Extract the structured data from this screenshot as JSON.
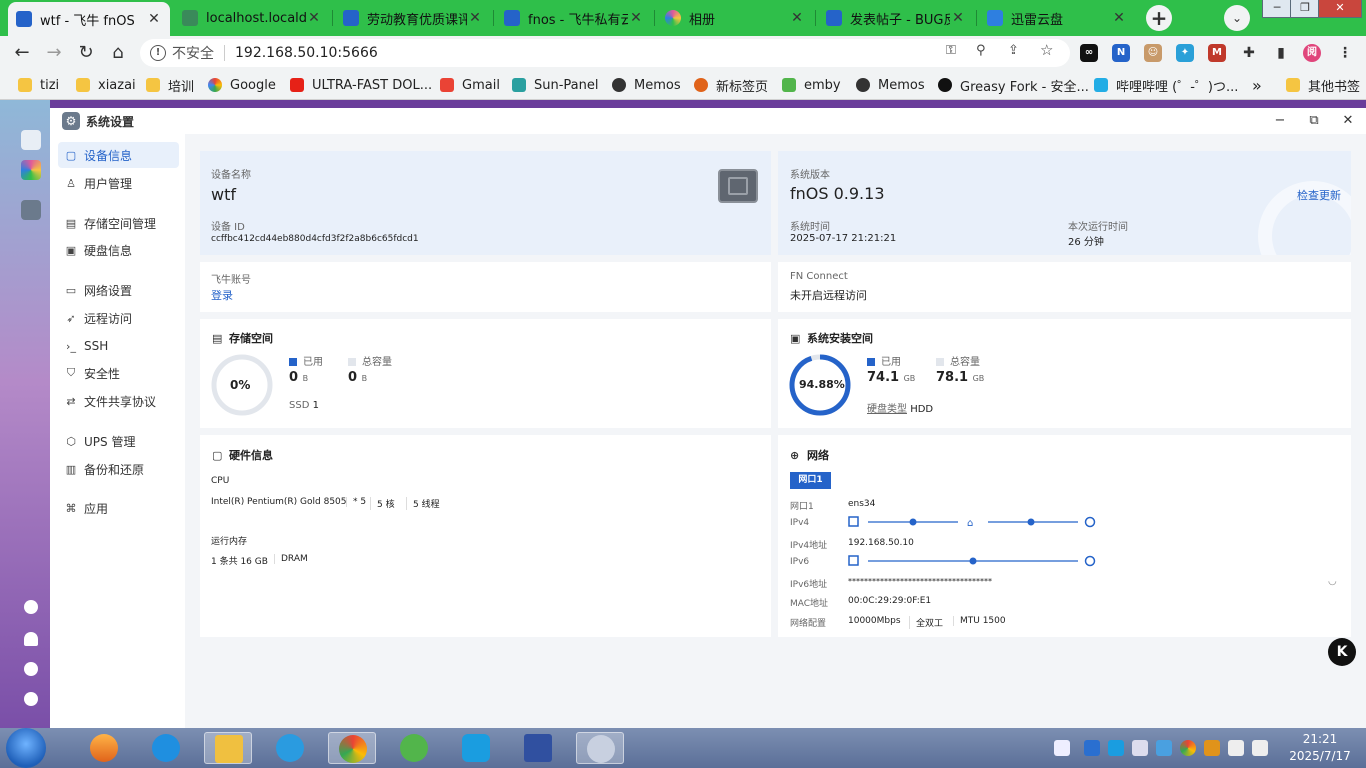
{
  "browser": {
    "tabs": [
      {
        "label": "wtf - 飞牛 fnOS",
        "color": "#2563c9",
        "active": true
      },
      {
        "label": "localhost.localdo",
        "color": "#3a8a5a"
      },
      {
        "label": "劳动教育优质课评",
        "color": "#2563c9"
      },
      {
        "label": "fnos - 飞牛私有云",
        "color": "#2563c9"
      },
      {
        "label": "相册",
        "color": "#e05a9a"
      },
      {
        "label": "发表帖子 - BUG反",
        "color": "#2563c9"
      },
      {
        "label": "迅雷云盘",
        "color": "#2e7fe0"
      }
    ],
    "close_glyph": "✕",
    "new_tab": "+",
    "address": {
      "insecure_label": "不安全",
      "url": "192.168.50.10:5666"
    },
    "bookmarks": [
      {
        "label": "tizi",
        "icon": "folder"
      },
      {
        "label": "xiazai",
        "icon": "folder"
      },
      {
        "label": "培训",
        "icon": "folder"
      },
      {
        "label": "Google",
        "icon": "google-icon"
      },
      {
        "label": "ULTRA-FAST DOL...",
        "icon": "youtube-icon"
      },
      {
        "label": "Gmail",
        "icon": "gmail-icon"
      },
      {
        "label": "Sun-Panel",
        "icon": "sun-panel-icon"
      },
      {
        "label": "Memos",
        "icon": "memos-icon"
      },
      {
        "label": "新标签页",
        "icon": "newtab-icon"
      },
      {
        "label": "emby",
        "icon": "emby-icon"
      },
      {
        "label": "Memos",
        "icon": "memos-icon"
      },
      {
        "label": "Greasy Fork - 安全...",
        "icon": "greasyfork-icon"
      },
      {
        "label": "哔哩哔哩 (゜-゜)つ...",
        "icon": "bilibili-icon"
      }
    ],
    "bookmarks_more": "»",
    "other_bookmarks": "其他书签"
  },
  "window": {
    "title": "系统设置",
    "controls": {
      "minimize": "−",
      "maximize": "⧉",
      "close": "✕"
    }
  },
  "nav": [
    {
      "label": "设备信息",
      "icon": "info-icon",
      "glyph": "▢",
      "active": true
    },
    {
      "label": "用户管理",
      "icon": "user-icon",
      "glyph": "♙"
    },
    {
      "label": "存储空间管理",
      "icon": "storage-icon",
      "glyph": "▤"
    },
    {
      "label": "硬盘信息",
      "icon": "disk-icon",
      "glyph": "▣"
    },
    {
      "label": "网络设置",
      "icon": "network-icon",
      "glyph": "▭"
    },
    {
      "label": "远程访问",
      "icon": "remote-icon",
      "glyph": "➶"
    },
    {
      "label": "SSH",
      "icon": "ssh-icon",
      "glyph": "›_"
    },
    {
      "label": "安全性",
      "icon": "shield-icon",
      "glyph": "⛉"
    },
    {
      "label": "文件共享协议",
      "icon": "share-icon",
      "glyph": "⇄"
    },
    {
      "label": "UPS 管理",
      "icon": "ups-icon",
      "glyph": "⬡"
    },
    {
      "label": "备份和还原",
      "icon": "backup-icon",
      "glyph": "▥"
    },
    {
      "label": "应用",
      "icon": "apps-icon",
      "glyph": "⌘"
    }
  ],
  "device": {
    "name_label": "设备名称",
    "name": "wtf",
    "id_label": "设备 ID",
    "id": "ccffbc412cd44eb880d4cfd3f2f2a8b6c65fdcd1",
    "account_label": "飞牛账号",
    "account_action": "登录"
  },
  "system": {
    "version_label": "系统版本",
    "version": "fnOS  0.9.13",
    "update_link": "检查更新",
    "time_label": "系统时间",
    "time": "2025-07-17 21:21:21",
    "uptime_label": "本次运行时间",
    "uptime": "26 分钟",
    "fnconnect_label": "FN Connect",
    "fnconnect": "未开启远程访问"
  },
  "storage": {
    "title": "存储空间",
    "percent": "0%",
    "used_label": "已用",
    "used": "0",
    "used_unit": "B",
    "total_label": "总容量",
    "total": "0",
    "total_unit": "B",
    "disk_type": "SSD",
    "disk_count": "1"
  },
  "sys_storage": {
    "title": "系统安装空间",
    "percent": "94.88%",
    "fill": 0.9488,
    "used_label": "已用",
    "used": "74.1",
    "used_unit": "GB",
    "total_label": "总容量",
    "total": "78.1",
    "total_unit": "GB",
    "disk_type_label": "硬盘类型",
    "disk_type": "HDD"
  },
  "hardware": {
    "title": "硬件信息",
    "cpu_label": "CPU",
    "cpu_model": "Intel(R) Pentium(R) Gold 8505",
    "cpu_count": "* 5",
    "cores": "5 核",
    "threads": "5 线程",
    "mem_label": "运行内存",
    "mem": "1 条共 16 GB",
    "mem_type": "DRAM"
  },
  "network": {
    "title": "网络",
    "port_tab": "网口1",
    "rows": [
      {
        "label": "网口1",
        "value": "ens34"
      },
      {
        "label": "IPv4",
        "value": ""
      },
      {
        "label": "IPv4地址",
        "value": "192.168.50.10"
      },
      {
        "label": "IPv6",
        "value": ""
      },
      {
        "label": "IPv6地址",
        "value": "************************************"
      },
      {
        "label": "MAC地址",
        "value": "00:0C:29:29:0F:E1"
      },
      {
        "label": "网络配置",
        "value": "10000Mbps"
      }
    ],
    "duplex": "全双工",
    "mtu": "MTU 1500"
  },
  "taskbar": {
    "time": "21:21",
    "date": "2025/7/17"
  },
  "colors": {
    "accent": "#2563c9",
    "ring_bg": "#e2e6ec",
    "tab_green": "#2fbf4a"
  }
}
